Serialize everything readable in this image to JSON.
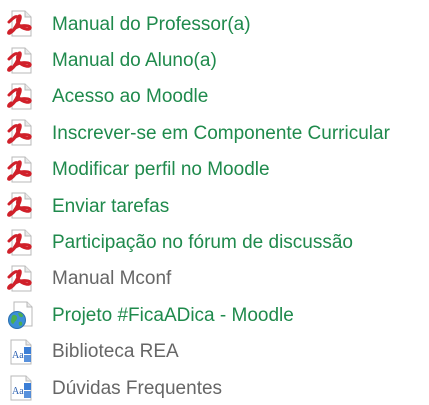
{
  "colors": {
    "link_active": "#1f8a4c",
    "link_visited": "#666666",
    "pdf_red": "#d0202a"
  },
  "links": {
    "items": [
      {
        "label": "Manual do Professor(a)",
        "icon": "pdf-icon",
        "style": "green"
      },
      {
        "label": "Manual do Aluno(a)",
        "icon": "pdf-icon",
        "style": "green"
      },
      {
        "label": "Acesso ao Moodle",
        "icon": "pdf-icon",
        "style": "green"
      },
      {
        "label": "Inscrever-se em Componente Curricular",
        "icon": "pdf-icon",
        "style": "green"
      },
      {
        "label": "Modificar perfil no Moodle",
        "icon": "pdf-icon",
        "style": "green"
      },
      {
        "label": "Enviar tarefas",
        "icon": "pdf-icon",
        "style": "green"
      },
      {
        "label": "Participação no fórum de discussão",
        "icon": "pdf-icon",
        "style": "green"
      },
      {
        "label": "Manual Mconf",
        "icon": "pdf-icon",
        "style": "gray"
      },
      {
        "label": "Projeto #FicaADica - Moodle",
        "icon": "web-page-icon",
        "style": "green"
      },
      {
        "label": "Biblioteca REA",
        "icon": "text-page-icon",
        "style": "gray"
      },
      {
        "label": "Dúvidas Frequentes",
        "icon": "text-page-icon",
        "style": "gray"
      }
    ]
  }
}
